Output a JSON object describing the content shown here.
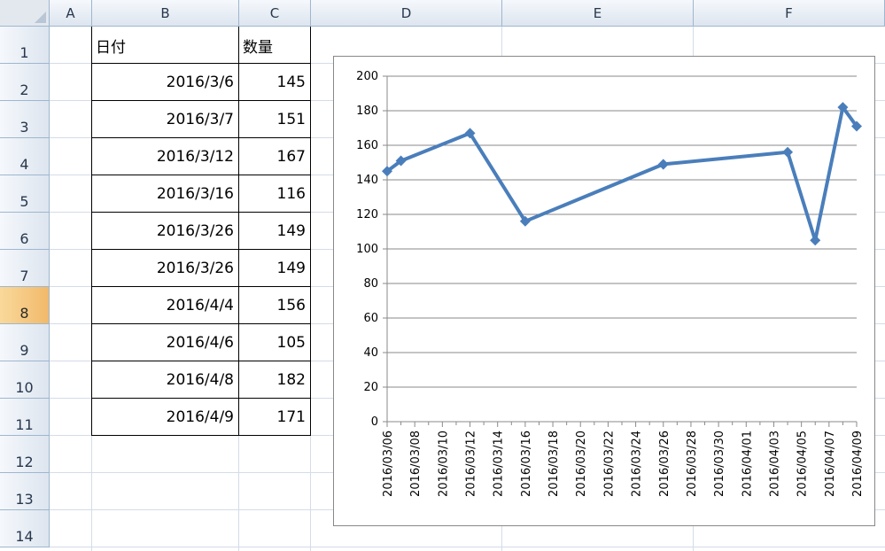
{
  "columns": [
    "A",
    "B",
    "C",
    "D",
    "E",
    "F"
  ],
  "rows": [
    "1",
    "2",
    "3",
    "4",
    "5",
    "6",
    "7",
    "8",
    "9",
    "10",
    "11",
    "12",
    "13",
    "14"
  ],
  "selected_row": "8",
  "table": {
    "headers": [
      "日付",
      "数量"
    ],
    "rows": [
      {
        "date": "2016/3/6",
        "qty": "145"
      },
      {
        "date": "2016/3/7",
        "qty": "151"
      },
      {
        "date": "2016/3/12",
        "qty": "167"
      },
      {
        "date": "2016/3/16",
        "qty": "116"
      },
      {
        "date": "2016/3/26",
        "qty": "149"
      },
      {
        "date": "2016/3/26",
        "qty": "149"
      },
      {
        "date": "2016/4/4",
        "qty": "156"
      },
      {
        "date": "2016/4/6",
        "qty": "105"
      },
      {
        "date": "2016/4/8",
        "qty": "182"
      },
      {
        "date": "2016/4/9",
        "qty": "171"
      }
    ]
  },
  "chart_data": {
    "type": "line",
    "title": "",
    "xlabel": "",
    "ylabel": "",
    "x_axis": "date",
    "ylim": [
      0,
      200
    ],
    "yticks": [
      0,
      20,
      40,
      60,
      80,
      100,
      120,
      140,
      160,
      180,
      200
    ],
    "xtick_labels": [
      "2016/03/06",
      "2016/03/08",
      "2016/03/10",
      "2016/03/12",
      "2016/03/14",
      "2016/03/16",
      "2016/03/18",
      "2016/03/20",
      "2016/03/22",
      "2016/03/24",
      "2016/03/26",
      "2016/03/28",
      "2016/03/30",
      "2016/04/01",
      "2016/04/03",
      "2016/04/05",
      "2016/04/07",
      "2016/04/09"
    ],
    "xlim": [
      "2016/03/06",
      "2016/04/09"
    ],
    "grid": "horizontal",
    "legend": "none",
    "series": [
      {
        "color": "#4a7ebb",
        "marker": "diamond",
        "points": [
          {
            "x": "2016/03/06",
            "y": 145
          },
          {
            "x": "2016/03/07",
            "y": 151
          },
          {
            "x": "2016/03/12",
            "y": 167
          },
          {
            "x": "2016/03/16",
            "y": 116
          },
          {
            "x": "2016/03/26",
            "y": 149
          },
          {
            "x": "2016/03/26",
            "y": 149
          },
          {
            "x": "2016/04/04",
            "y": 156
          },
          {
            "x": "2016/04/06",
            "y": 105
          },
          {
            "x": "2016/04/08",
            "y": 182
          },
          {
            "x": "2016/04/09",
            "y": 171
          }
        ]
      }
    ]
  }
}
